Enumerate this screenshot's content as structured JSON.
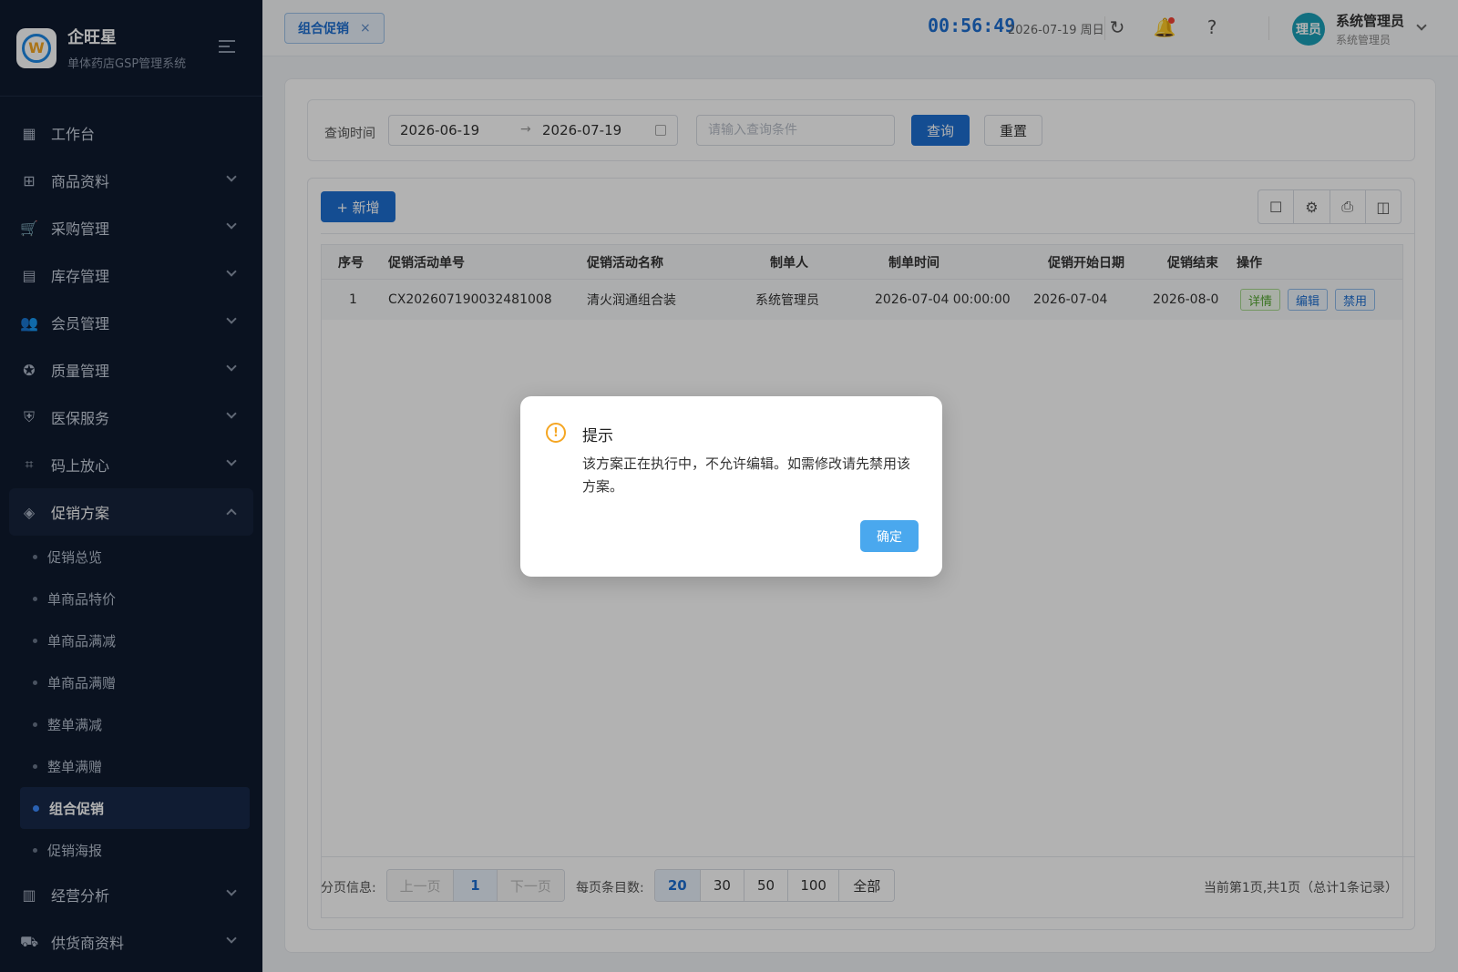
{
  "app": {
    "name": "企旺星",
    "subtitle": "单体药店GSP管理系统",
    "logo_letter": "W"
  },
  "sidebar": {
    "items": [
      {
        "label": "工作台",
        "icon": "dashboard-icon",
        "glyph": "▦"
      },
      {
        "label": "商品资料",
        "icon": "product-icon",
        "glyph": "⊞"
      },
      {
        "label": "采购管理",
        "icon": "cart-icon",
        "glyph": "🛒"
      },
      {
        "label": "库存管理",
        "icon": "inventory-icon",
        "glyph": "▤"
      },
      {
        "label": "会员管理",
        "icon": "members-icon",
        "glyph": "👥"
      },
      {
        "label": "质量管理",
        "icon": "quality-icon",
        "glyph": "✪"
      },
      {
        "label": "医保服务",
        "icon": "shield-icon",
        "glyph": "⛨"
      },
      {
        "label": "码上放心",
        "icon": "qrcode-icon",
        "glyph": "⌗"
      },
      {
        "label": "促销方案",
        "icon": "tag-icon",
        "glyph": "◈"
      }
    ],
    "sub_items": [
      "促销总览",
      "单商品特价",
      "单商品满减",
      "单商品满赠",
      "整单满减",
      "整单满赠",
      "组合促销",
      "促销海报"
    ],
    "bottom_items": [
      {
        "label": "经营分析",
        "icon": "chart-icon",
        "glyph": "▥"
      },
      {
        "label": "供货商资料",
        "icon": "truck-icon",
        "glyph": "⛟"
      }
    ]
  },
  "header": {
    "tab_label": "组合促销",
    "tab_close": "×",
    "clock": "00:56:49",
    "date": "2026-07-19 周日",
    "avatar_text": "理员",
    "user_name": "系统管理员",
    "user_role": "系统管理员"
  },
  "query": {
    "label": "查询时间",
    "date_start": "2026-06-19",
    "date_sep": "→",
    "date_end": "2026-07-19",
    "placeholder": "请输入查询条件",
    "search_btn": "查询",
    "reset_btn": "重置"
  },
  "toolbar": {
    "add_btn": "+ 新增"
  },
  "table": {
    "columns": [
      "序号",
      "促销活动单号",
      "促销活动名称",
      "制单人",
      "制单时间",
      "促销开始日期",
      "促销结束",
      "操作"
    ],
    "rows": [
      {
        "index": "1",
        "order_no": "CX202607190032481008",
        "name": "清火润通组合装",
        "creator": "系统管理员",
        "created_at": "2026-07-04 00:00:00",
        "start_date": "2026-07-04",
        "end_date": "2026-08-0",
        "actions": [
          "详情",
          "编辑",
          "禁用"
        ]
      }
    ]
  },
  "pager": {
    "label": "分页信息:",
    "prev": "上一页",
    "current": "1",
    "next": "下一页",
    "size_label": "每页条目数:",
    "sizes": [
      "20",
      "30",
      "50",
      "100",
      "全部"
    ],
    "summary": "当前第1页,共1页（总计1条记录）"
  },
  "modal": {
    "title": "提示",
    "message": "该方案正在执行中，不允许编辑。如需修改请先禁用该方案。",
    "ok": "确定"
  }
}
